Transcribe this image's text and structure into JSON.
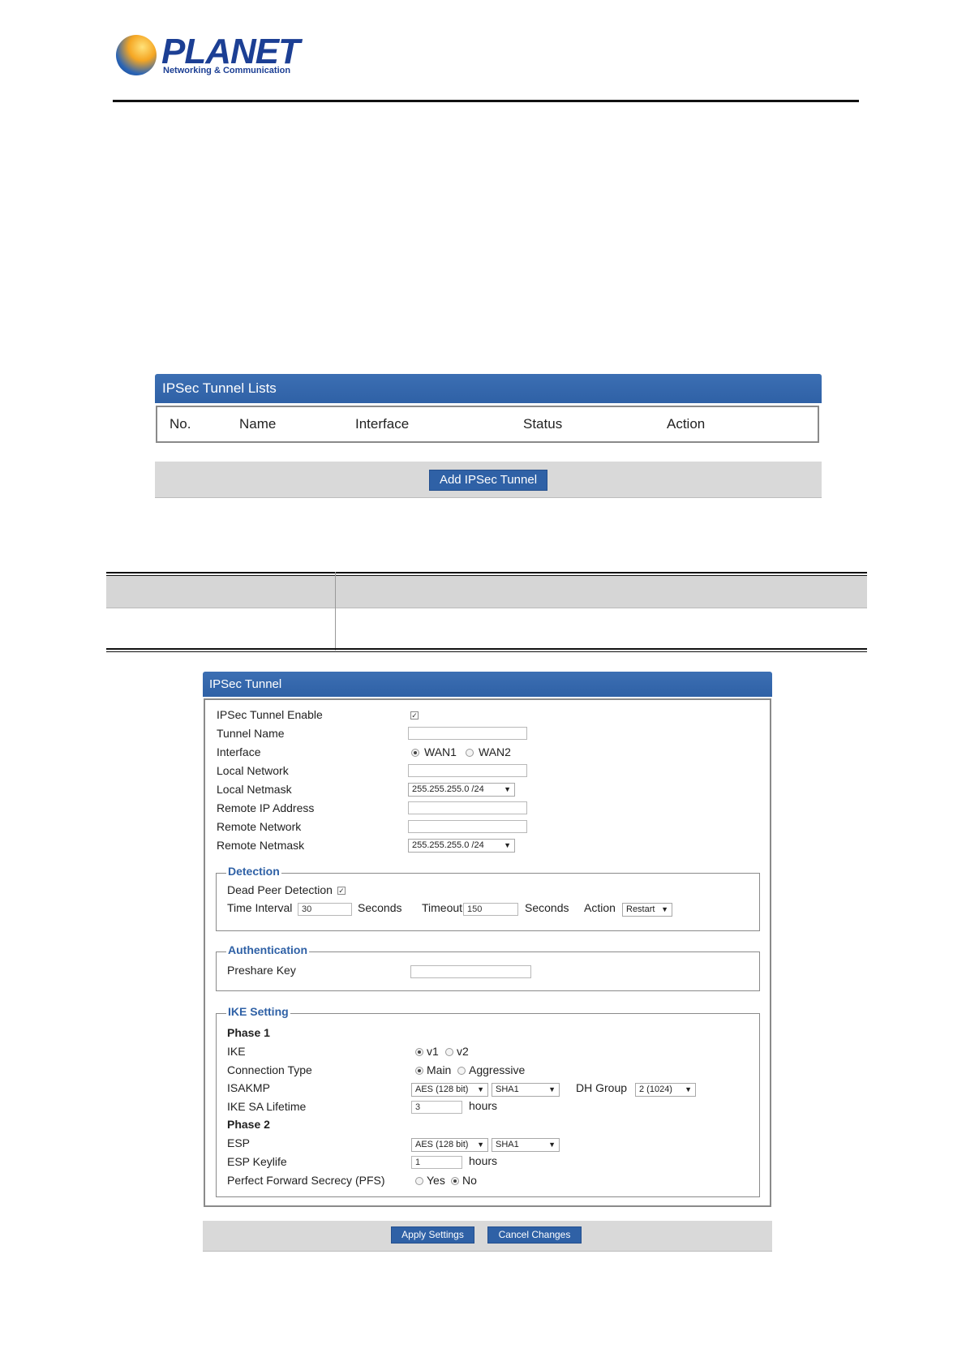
{
  "logo": {
    "name": "PLANET",
    "tagline": "Networking & Communication"
  },
  "tunnel_list": {
    "title": "IPSec Tunnel Lists",
    "columns": [
      "No.",
      "Name",
      "Interface",
      "Status",
      "Action"
    ],
    "add_button": "Add IPSec Tunnel"
  },
  "ipsec_tunnel": {
    "title": "IPSec Tunnel",
    "enable_label": "IPSec Tunnel Enable",
    "enable_checked": true,
    "tunnel_name_label": "Tunnel Name",
    "tunnel_name_value": "",
    "interface_label": "Interface",
    "interface_options": [
      "WAN1",
      "WAN2"
    ],
    "interface_selected": "WAN1",
    "local_network_label": "Local Network",
    "local_network_value": "",
    "local_netmask_label": "Local Netmask",
    "local_netmask_value": "255.255.255.0 /24",
    "remote_ip_label": "Remote IP Address",
    "remote_ip_value": "",
    "remote_network_label": "Remote Network",
    "remote_network_value": "",
    "remote_netmask_label": "Remote Netmask",
    "remote_netmask_value": "255.255.255.0 /24",
    "detection": {
      "legend": "Detection",
      "dpd_label": "Dead Peer Detection",
      "dpd_checked": true,
      "time_interval_label": "Time Interval",
      "time_interval_value": "30",
      "seconds_label_1": "Seconds",
      "timeout_label": "Timeout",
      "timeout_value": "150",
      "seconds_label_2": "Seconds",
      "action_label": "Action",
      "action_value": "Restart"
    },
    "authentication": {
      "legend": "Authentication",
      "preshare_label": "Preshare Key",
      "preshare_value": ""
    },
    "ike": {
      "legend": "IKE Setting",
      "phase1_label": "Phase 1",
      "ike_label": "IKE",
      "ike_options": [
        "v1",
        "v2"
      ],
      "ike_selected": "v1",
      "conn_type_label": "Connection Type",
      "conn_type_options": [
        "Main",
        "Aggressive"
      ],
      "conn_type_selected": "Main",
      "isakmp_label": "ISAKMP",
      "isakmp_enc": "AES (128 bit)",
      "isakmp_hash": "SHA1",
      "dh_group_label": "DH Group",
      "dh_group_value": "2 (1024)",
      "sa_lifetime_label": "IKE SA Lifetime",
      "sa_lifetime_value": "3",
      "hours_label_1": "hours",
      "phase2_label": "Phase 2",
      "esp_label": "ESP",
      "esp_enc": "AES (128 bit)",
      "esp_hash": "SHA1",
      "esp_keylife_label": "ESP Keylife",
      "esp_keylife_value": "1",
      "hours_label_2": "hours",
      "pfs_label": "Perfect Forward Secrecy (PFS)",
      "pfs_options": [
        "Yes",
        "No"
      ],
      "pfs_selected": "No"
    },
    "apply_button": "Apply Settings",
    "cancel_button": "Cancel Changes"
  },
  "colors": {
    "accent_blue": "#2f61a6",
    "bar_gray": "#d9d9d9"
  }
}
